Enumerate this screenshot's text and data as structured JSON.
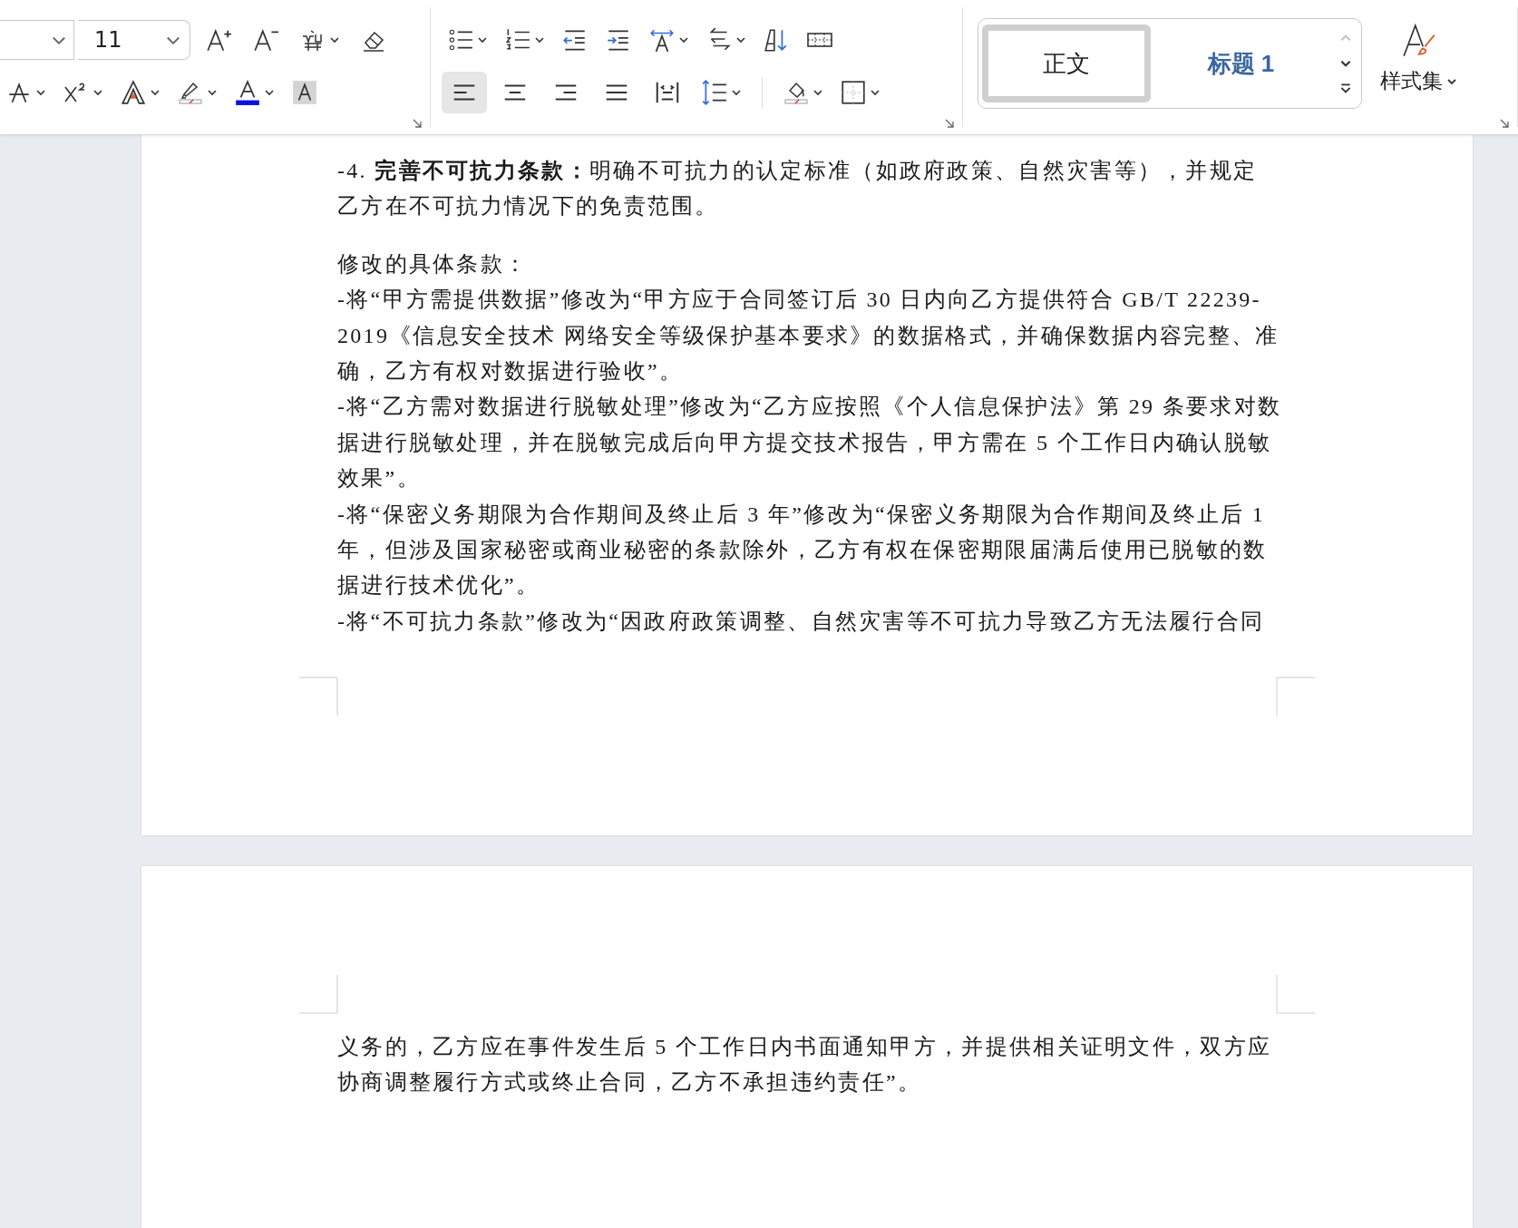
{
  "toolbar": {
    "font_size": "11",
    "alignment": [
      {
        "selected": true
      },
      {
        "selected": false
      },
      {
        "selected": false
      },
      {
        "selected": false
      },
      {
        "selected": false
      }
    ],
    "style_gallery": [
      {
        "label": "正文",
        "kind": "body",
        "selected": true
      },
      {
        "label": "标题 1",
        "kind": "heading",
        "selected": false
      }
    ],
    "styles_button": "样式集"
  },
  "pages": [
    {
      "sections": [
        [
          {
            "lines": [
              "-4. **完善不可抗力条款：**明确不可抗力的认定标准（如政府政策、自然灾害等），并规定",
              "乙方在不可抗力情况下的免责范围。"
            ]
          }
        ],
        [
          {
            "lines": [
              "修改的具体条款："
            ]
          },
          {
            "lines": [
              "-将“甲方需提供数据”修改为“甲方应于合同签订后 30 日内向乙方提供符合 GB/T 22239-",
              "2019《信息安全技术 网络安全等级保护基本要求》的数据格式，并确保数据内容完整、准",
              "确，乙方有权对数据进行验收”。"
            ]
          },
          {
            "lines": [
              "-将“乙方需对数据进行脱敏处理”修改为“乙方应按照《个人信息保护法》第 29 条要求对数",
              "据进行脱敏处理，并在脱敏完成后向甲方提交技术报告，甲方需在 5 个工作日内确认脱敏",
              "效果”。"
            ]
          },
          {
            "lines": [
              "-将“保密义务期限为合作期间及终止后 3 年”修改为“保密义务期限为合作期间及终止后 1",
              "年，但涉及国家秘密或商业秘密的条款除外，乙方有权在保密期限届满后使用已脱敏的数",
              "据进行技术优化”。"
            ]
          },
          {
            "lines": [
              "-将“不可抗力条款”修改为“因政府政策调整、自然灾害等不可抗力导致乙方无法履行合同"
            ]
          }
        ]
      ]
    },
    {
      "sections": [
        [
          {
            "lines": [
              "义务的，乙方应在事件发生后 5 个工作日内书面通知甲方，并提供相关证明文件，双方应",
              "协商调整履行方式或终止合同，乙方不承担违约责任”。"
            ]
          }
        ]
      ]
    }
  ]
}
